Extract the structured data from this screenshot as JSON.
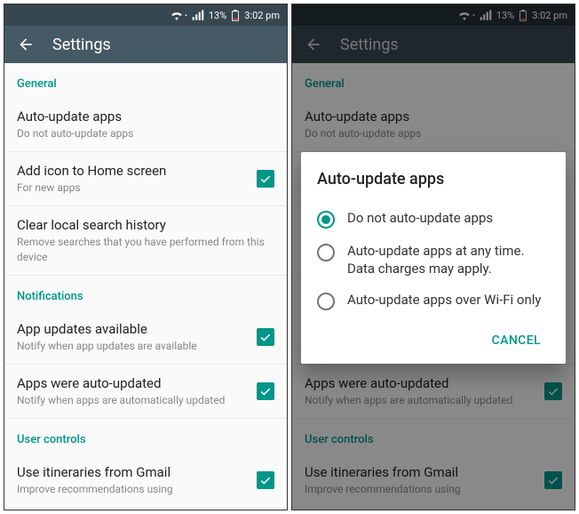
{
  "status": {
    "battery": "13%",
    "time": "3:02 pm"
  },
  "header": {
    "title": "Settings"
  },
  "sections": {
    "general": {
      "label": "General"
    },
    "notifications": {
      "label": "Notifications"
    },
    "user_controls": {
      "label": "User controls"
    }
  },
  "items": {
    "auto_update": {
      "title": "Auto-update apps",
      "subtitle": "Do not auto-update apps"
    },
    "add_icon": {
      "title": "Add icon to Home screen",
      "subtitle": "For new apps"
    },
    "clear_search": {
      "title": "Clear local search history",
      "subtitle": "Remove searches that you have performed from this device"
    },
    "updates_available": {
      "title": "App updates available",
      "subtitle": "Notify when app updates are available"
    },
    "auto_updated": {
      "title": "Apps were auto-updated",
      "subtitle": "Notify when apps are automatically updated"
    },
    "itineraries": {
      "title": "Use itineraries from Gmail",
      "subtitle": "Improve recommendations using"
    }
  },
  "dialog": {
    "title": "Auto-update apps",
    "options": {
      "o0": "Do not auto-update apps",
      "o1": "Auto-update apps at any time. Data charges may apply.",
      "o2": "Auto-update apps over Wi-Fi only"
    },
    "cancel": "CANCEL"
  }
}
